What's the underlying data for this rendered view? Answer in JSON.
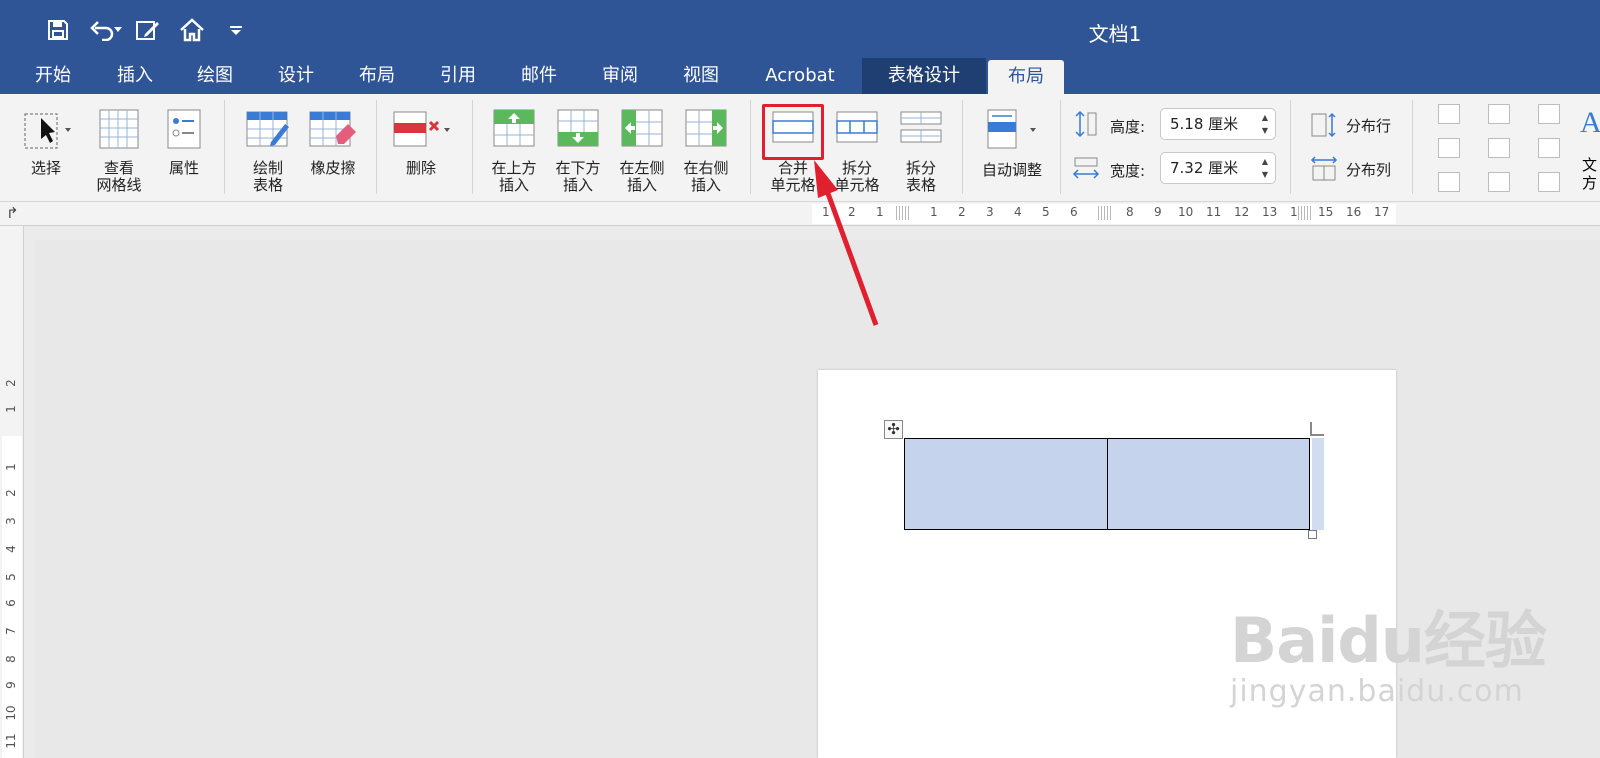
{
  "window": {
    "title": "文档1"
  },
  "qat": {
    "icons": [
      "save-icon",
      "undo-icon",
      "undo-dropdown-icon",
      "edit-document-icon",
      "home-icon",
      "customize-qat-icon"
    ]
  },
  "tabs": [
    {
      "label": "开始"
    },
    {
      "label": "插入"
    },
    {
      "label": "绘图"
    },
    {
      "label": "设计"
    },
    {
      "label": "布局"
    },
    {
      "label": "引用"
    },
    {
      "label": "邮件"
    },
    {
      "label": "审阅"
    },
    {
      "label": "视图"
    },
    {
      "label": "Acrobat"
    },
    {
      "label": "表格设计"
    },
    {
      "label": "布局"
    }
  ],
  "ribbon": {
    "select": "选择",
    "view_gridlines": "查看\n网格线",
    "properties": "属性",
    "draw_table": "绘制\n表格",
    "eraser": "橡皮擦",
    "delete": "删除",
    "insert_above": "在上方\n插入",
    "insert_below": "在下方\n插入",
    "insert_left": "在左侧\n插入",
    "insert_right": "在右侧\n插入",
    "merge_cells": "合并\n单元格",
    "split_cells": "拆分\n单元格",
    "split_table": "拆分\n表格",
    "autofit": "自动调整",
    "height_label": "高度:",
    "height_value": "5.18 厘米",
    "width_label": "宽度:",
    "width_value": "7.32 厘米",
    "distribute_rows": "分布行",
    "distribute_cols": "分布列",
    "text_direction_partial_1": "文",
    "text_direction_partial_2": "方"
  },
  "ruler": {
    "h_left_nums": [
      "1",
      "2",
      "1"
    ],
    "h_nums": [
      "1",
      "2",
      "3",
      "4",
      "5",
      "6",
      "8",
      "9",
      "10",
      "11",
      "12",
      "13",
      "1",
      "15",
      "16",
      "17"
    ],
    "v_nums": [
      "2",
      "1",
      "1",
      "2",
      "3",
      "4",
      "5",
      "6",
      "7",
      "8",
      "9",
      "10",
      "11"
    ]
  },
  "watermark": {
    "logo": "Baidu经验",
    "url": "jingyan.baidu.com"
  },
  "colors": {
    "ribbon_blue": "#2f5597",
    "cell_highlight": "#c5d3ed",
    "annotation_red": "#e0202e"
  }
}
